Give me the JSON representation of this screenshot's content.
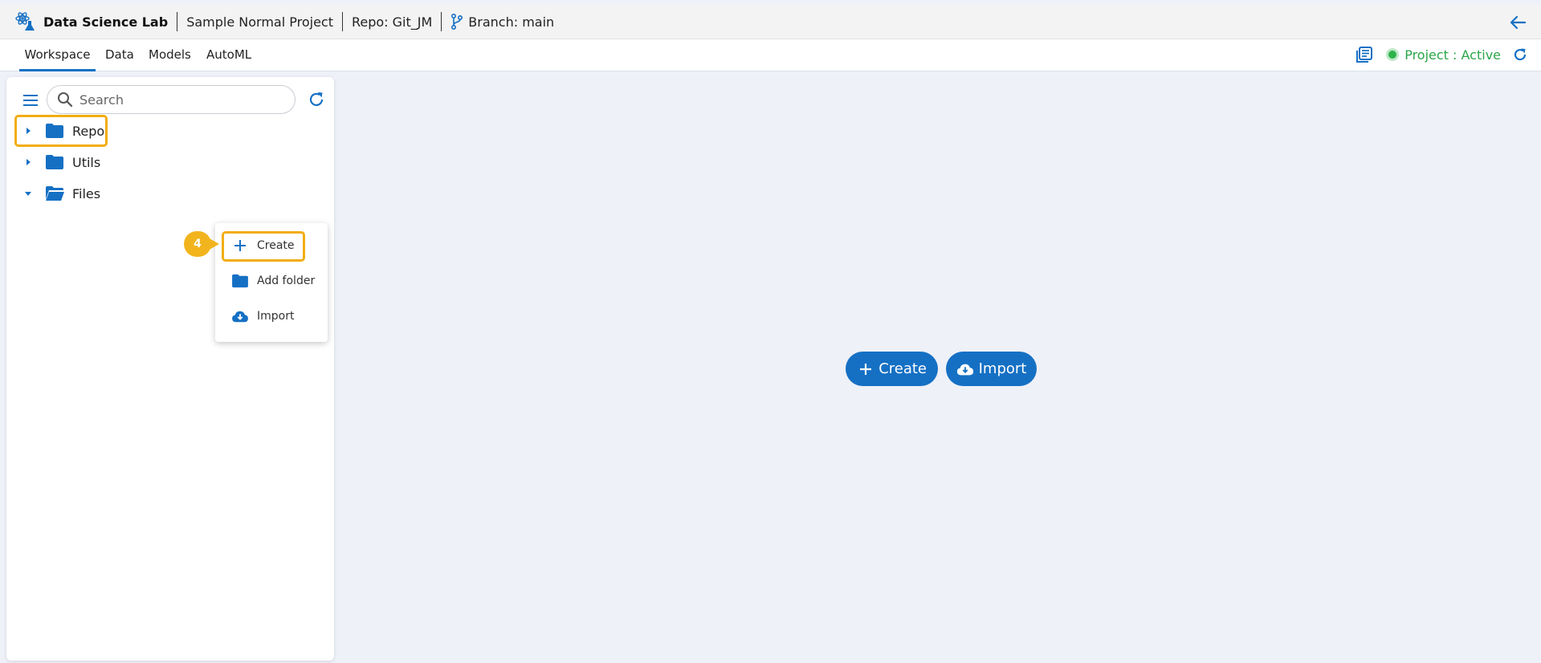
{
  "header": {
    "app_title": "Data Science Lab",
    "project_name": "Sample Normal Project",
    "repo": "Repo: Git_JM",
    "branch": "Branch: main",
    "icons": {
      "logo": "atom-flask-icon",
      "branch": "git-branch-icon",
      "back": "arrow-left-icon"
    }
  },
  "tabs": [
    {
      "label": "Workspace",
      "active": true
    },
    {
      "label": "Data",
      "active": false
    },
    {
      "label": "Models",
      "active": false
    },
    {
      "label": "AutoML",
      "active": false
    }
  ],
  "status": {
    "text": "Project : Active",
    "color": "#2aa548"
  },
  "sidebar": {
    "search_placeholder": "Search",
    "tree": [
      {
        "label": "Repo",
        "expanded": false
      },
      {
        "label": "Utils",
        "expanded": false
      },
      {
        "label": "Files",
        "expanded": true
      }
    ]
  },
  "context_menu": {
    "items": [
      {
        "label": "Create",
        "icon": "plus-icon"
      },
      {
        "label": "Add folder",
        "icon": "folder-icon"
      },
      {
        "label": "Import",
        "icon": "cloud-download-icon"
      }
    ]
  },
  "step_badge": "4",
  "main": {
    "create_label": "Create",
    "import_label": "Import"
  },
  "colors": {
    "accent": "#1570c4",
    "highlight": "#f2ad12",
    "badge": "#f2b41c",
    "background": "#eef1f8"
  }
}
